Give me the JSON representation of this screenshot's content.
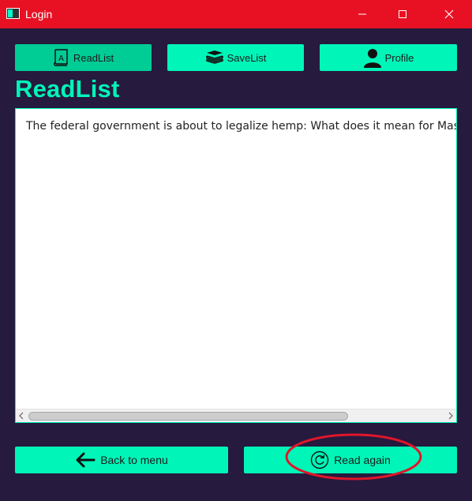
{
  "window": {
    "title": "Login",
    "titlebar_color": "#e81123",
    "icons": [
      "app-icon",
      "minimize-icon",
      "maximize-icon",
      "close-icon"
    ]
  },
  "nav": {
    "tabs": [
      {
        "label": "ReadList",
        "icon": "book-icon",
        "active": true
      },
      {
        "label": "SaveList",
        "icon": "stack-icon",
        "active": false
      },
      {
        "label": "Profile",
        "icon": "user-icon",
        "active": false
      }
    ]
  },
  "page": {
    "title": "ReadList"
  },
  "list": {
    "items": [
      "The federal government is about to legalize hemp: What does it mean for Massachusetts?"
    ]
  },
  "actions": {
    "back_label": "Back to menu",
    "back_icon": "arrow-left-icon",
    "read_again_label": "Read again",
    "read_again_icon": "refresh-icon"
  },
  "colors": {
    "background": "#261a3e",
    "accent": "#00f5b8",
    "accent_active": "#00cc96",
    "annotation": "#e0162b"
  }
}
